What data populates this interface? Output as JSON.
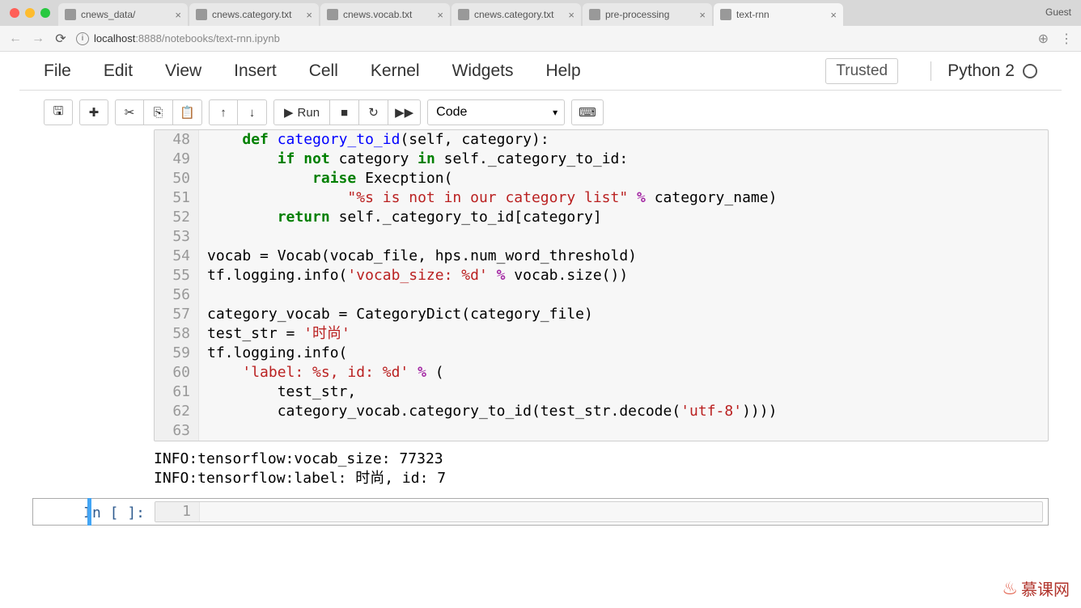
{
  "browser": {
    "guest": "Guest",
    "tabs": [
      {
        "title": "cnews_data/",
        "active": false
      },
      {
        "title": "cnews.category.txt",
        "active": false
      },
      {
        "title": "cnews.vocab.txt",
        "active": false
      },
      {
        "title": "cnews.category.txt",
        "active": false
      },
      {
        "title": "pre-processing",
        "active": false
      },
      {
        "title": "text-rnn",
        "active": true
      }
    ],
    "url_host": "localhost",
    "url_port": ":8888",
    "url_path": "/notebooks/text-rnn.ipynb"
  },
  "menu": {
    "items": [
      "File",
      "Edit",
      "View",
      "Insert",
      "Cell",
      "Kernel",
      "Widgets",
      "Help"
    ],
    "trusted": "Trusted",
    "kernel": "Python 2"
  },
  "toolbar": {
    "run": "Run",
    "cell_type": "Code"
  },
  "code_lines": [
    {
      "n": 48,
      "html": "    <span class='kw'>def</span> <span class='def'>category_to_id</span>(<span class='selfc'>self</span>, category):"
    },
    {
      "n": 49,
      "html": "        <span class='kw'>if</span> <span class='kw'>not</span> category <span class='kw'>in</span> self._category_to_id:"
    },
    {
      "n": 50,
      "html": "            <span class='kw'>raise</span> Execption("
    },
    {
      "n": 51,
      "html": "                <span class='str'>\"%s is not in our category list\"</span> <span class='op'>%</span> category_name)"
    },
    {
      "n": 52,
      "html": "        <span class='kw'>return</span> self._category_to_id[category]"
    },
    {
      "n": 53,
      "html": ""
    },
    {
      "n": 54,
      "html": "vocab = Vocab(vocab_file, hps.num_word_threshold)"
    },
    {
      "n": 55,
      "html": "tf.logging.info(<span class='str'>'vocab_size: %d'</span> <span class='op'>%</span> vocab.size())"
    },
    {
      "n": 56,
      "html": ""
    },
    {
      "n": 57,
      "html": "category_vocab = CategoryDict(category_file)"
    },
    {
      "n": 58,
      "html": "test_str = <span class='str'>'时尚'</span>"
    },
    {
      "n": 59,
      "html": "tf.logging.info("
    },
    {
      "n": 60,
      "html": "    <span class='str'>'label: %s, id: %d'</span> <span class='op'>%</span> ("
    },
    {
      "n": 61,
      "html": "        test_str,"
    },
    {
      "n": 62,
      "html": "        category_vocab.category_to_id(test_str.decode(<span class='str'>'utf-8'</span>))))"
    },
    {
      "n": 63,
      "html": ""
    }
  ],
  "output": "INFO:tensorflow:vocab_size: 77323\nINFO:tensorflow:label: 时尚, id: 7",
  "empty_prompt": "In [ ]:",
  "empty_line_num": "1",
  "watermark": "慕课网"
}
